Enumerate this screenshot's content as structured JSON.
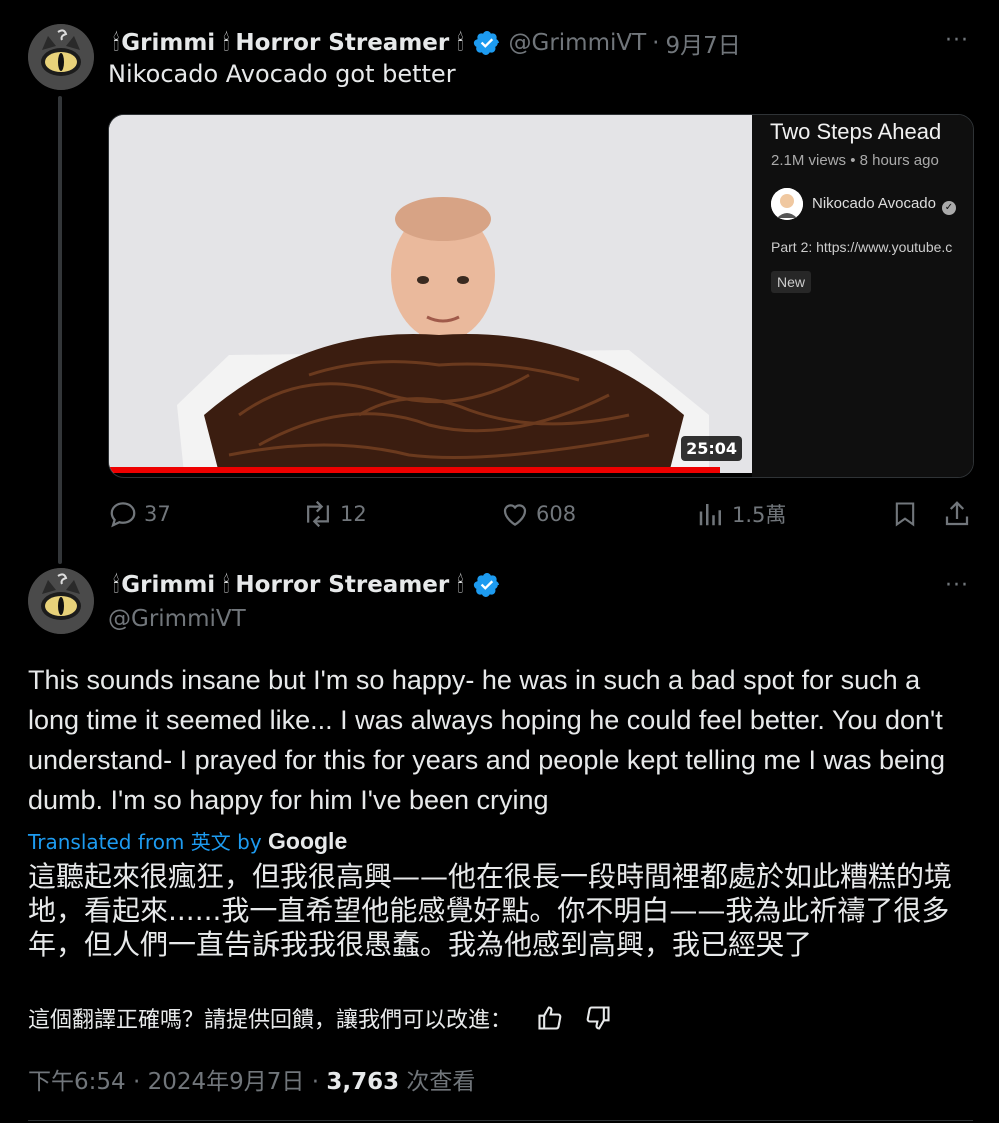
{
  "tweet1": {
    "display_name": "Grimmi",
    "display_name_suffix": "Horror Streamer",
    "candle_emoji": "🕯",
    "handle": "@GrimmiVT",
    "separator": "·",
    "date": "9月7日",
    "more": "···",
    "text": "Nikocado Avocado got better",
    "card": {
      "duration": "25:04",
      "progress_fraction": 0.95,
      "title": "Two Steps Ahead",
      "meta": "2.1M views • 8 hours ago",
      "channel": "Nikocado Avocado",
      "description": "Part 2: https://www.youtube.c",
      "badge": "New"
    },
    "actions": {
      "replies": "37",
      "reposts": "12",
      "likes": "608",
      "views": "1.5萬"
    }
  },
  "tweet2": {
    "display_name": "Grimmi",
    "display_name_suffix": "Horror Streamer",
    "candle_emoji": "🕯",
    "handle": "@GrimmiVT",
    "more": "···",
    "text": "This sounds insane but I'm so happy- he was in such a bad spot for such a long time it seemed like... I was always hoping he could feel better. You don't understand- I prayed for this for years and people kept telling me I was being dumb. I'm so happy for him I've been crying",
    "translated_prefix": "Translated from 英文 by",
    "translated_brand": "Google",
    "translation": "這聽起來很瘋狂，但我很高興——他在很長一段時間裡都處於如此糟糕的境地，看起來......我一直希望他能感覺好點。你不明白——我為此祈禱了很多年，但人們一直告訴我我很愚蠢。我為他感到高興，我已經哭了",
    "feedback_prompt": "這個翻譯正確嗎？請提供回饋，讓我們可以改進：",
    "time": "下午6:54",
    "separator": "·",
    "date": "2024年9月7日",
    "view_count": "3,763",
    "view_label": "次查看"
  },
  "colors": {
    "background": "#000000",
    "text": "#e7e9ea",
    "muted": "#71767b",
    "link": "#1d9bf0",
    "verified": "#1d9bf0",
    "video_progress": "#ee0000"
  },
  "icons": [
    "avatar-cat-eye",
    "verified-badge-icon",
    "reply-icon",
    "repost-icon",
    "like-icon",
    "views-icon",
    "bookmark-icon",
    "share-icon",
    "thumbs-up-icon",
    "thumbs-down-icon"
  ]
}
